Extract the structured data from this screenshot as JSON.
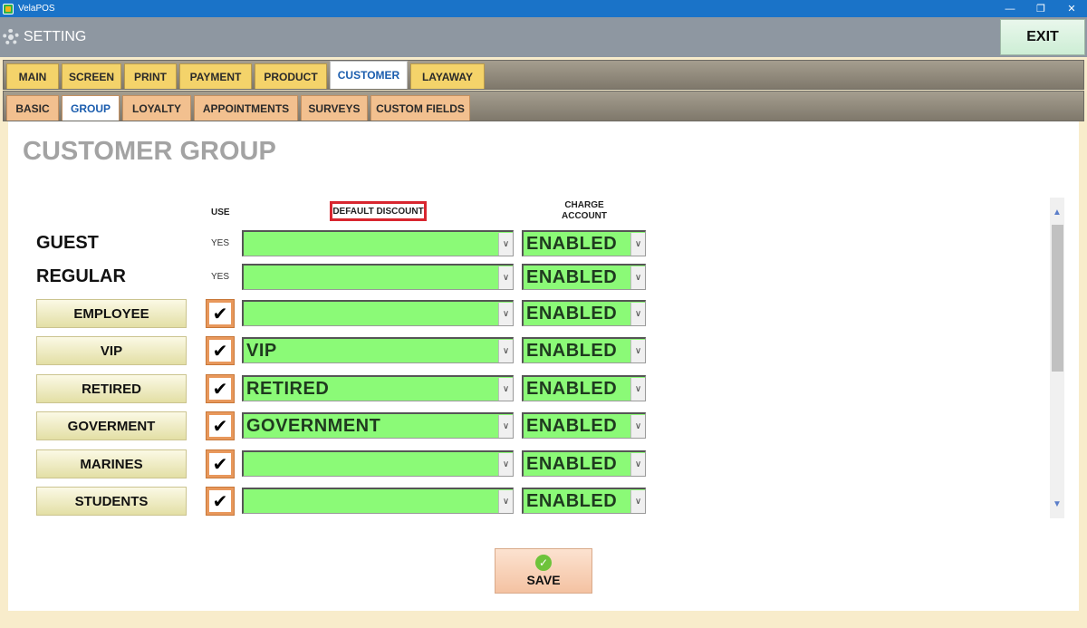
{
  "window": {
    "title": "VelaPOS",
    "controls": [
      "—",
      "❐",
      "✕"
    ]
  },
  "header": {
    "title": "SETTING",
    "exit_label": "EXIT"
  },
  "main_tabs": [
    "MAIN",
    "SCREEN",
    "PRINT",
    "PAYMENT",
    "PRODUCT",
    "CUSTOMER",
    "LAYAWAY"
  ],
  "main_active": "CUSTOMER",
  "sub_tabs": [
    "BASIC",
    "GROUP",
    "LOYALTY",
    "APPOINTMENTS",
    "SURVEYS",
    "CUSTOM FIELDS"
  ],
  "sub_active": "GROUP",
  "page_title": "CUSTOMER GROUP",
  "columns": {
    "use": "USE",
    "default_discount": "DEFAULT DISCOUNT",
    "charge_account": "CHARGE\nACCOUNT"
  },
  "rows": [
    {
      "name": "GUEST",
      "type": "label",
      "use": "YES",
      "discount": "",
      "charge": "ENABLED"
    },
    {
      "name": "REGULAR",
      "type": "label",
      "use": "YES",
      "discount": "",
      "charge": "ENABLED"
    },
    {
      "name": "EMPLOYEE",
      "type": "button",
      "use": "✔",
      "discount": "",
      "charge": "ENABLED"
    },
    {
      "name": "VIP",
      "type": "button",
      "use": "✔",
      "discount": "VIP",
      "charge": "ENABLED"
    },
    {
      "name": "RETIRED",
      "type": "button",
      "use": "✔",
      "discount": "RETIRED",
      "charge": "ENABLED"
    },
    {
      "name": "GOVERMENT",
      "type": "button",
      "use": "✔",
      "discount": "GOVERNMENT",
      "charge": "ENABLED"
    },
    {
      "name": "MARINES",
      "type": "button",
      "use": "✔",
      "discount": "",
      "charge": "ENABLED"
    },
    {
      "name": "STUDENTS",
      "type": "button",
      "use": "✔",
      "discount": "",
      "charge": "ENABLED"
    }
  ],
  "save_label": "SAVE",
  "icons": {
    "settings": "gear-icon",
    "save": "check-circle-icon",
    "dropdown": "chevron-down-icon"
  },
  "colors": {
    "select_bg": "#8bfa77",
    "highlight": "#d8262f",
    "title_bar": "#1a73c8"
  }
}
